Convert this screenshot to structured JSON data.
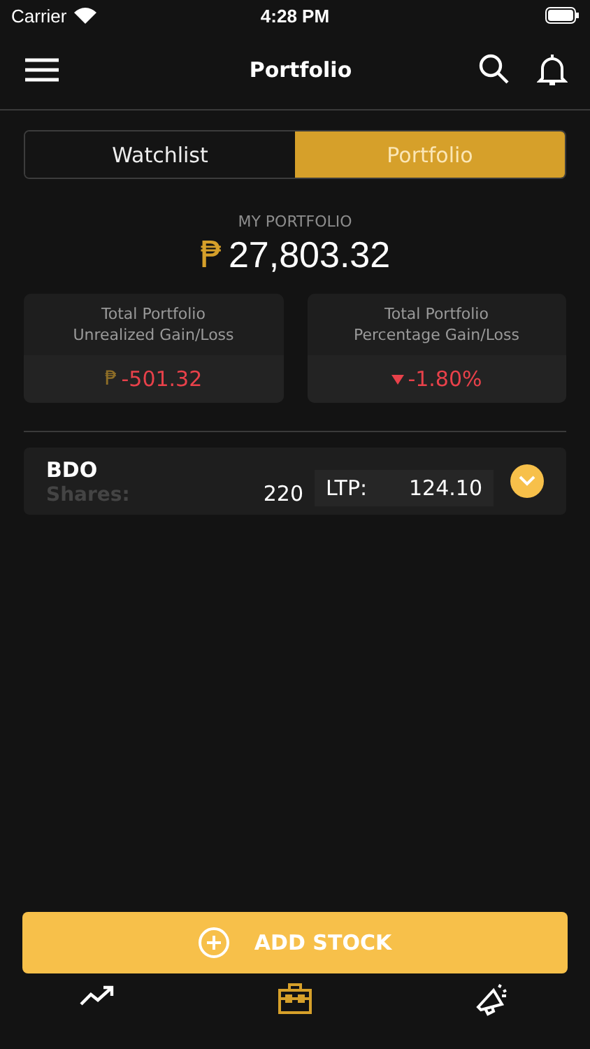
{
  "status_bar": {
    "carrier": "Carrier",
    "time": "4:28 PM"
  },
  "header": {
    "title": "Portfolio"
  },
  "tabs": [
    {
      "label": "Watchlist",
      "selected": false
    },
    {
      "label": "Portfolio",
      "selected": true
    }
  ],
  "portfolio": {
    "label": "MY PORTFOLIO",
    "currency": "₱",
    "value": "27,803.32"
  },
  "summary_cards": [
    {
      "kind": "currency",
      "title": "Total Portfolio",
      "subtitle": "Unrealized Gain/Loss",
      "currency": "₱",
      "value": "-501.32",
      "negative": true
    },
    {
      "kind": "percent",
      "title": "Total Portfolio",
      "subtitle": "Percentage Gain/Loss",
      "value": "-1.80%",
      "negative": true
    }
  ],
  "stocks": [
    {
      "symbol": "BDO",
      "shares_label": "Shares:",
      "shares": "220",
      "ltp_label": "LTP:",
      "ltp": "124.10",
      "expanded": false
    }
  ],
  "add_button": {
    "label": "ADD STOCK"
  },
  "bottom_nav": [
    {
      "kind": "market",
      "selected": false
    },
    {
      "kind": "portfolio",
      "selected": true
    },
    {
      "kind": "news",
      "selected": false
    }
  ]
}
